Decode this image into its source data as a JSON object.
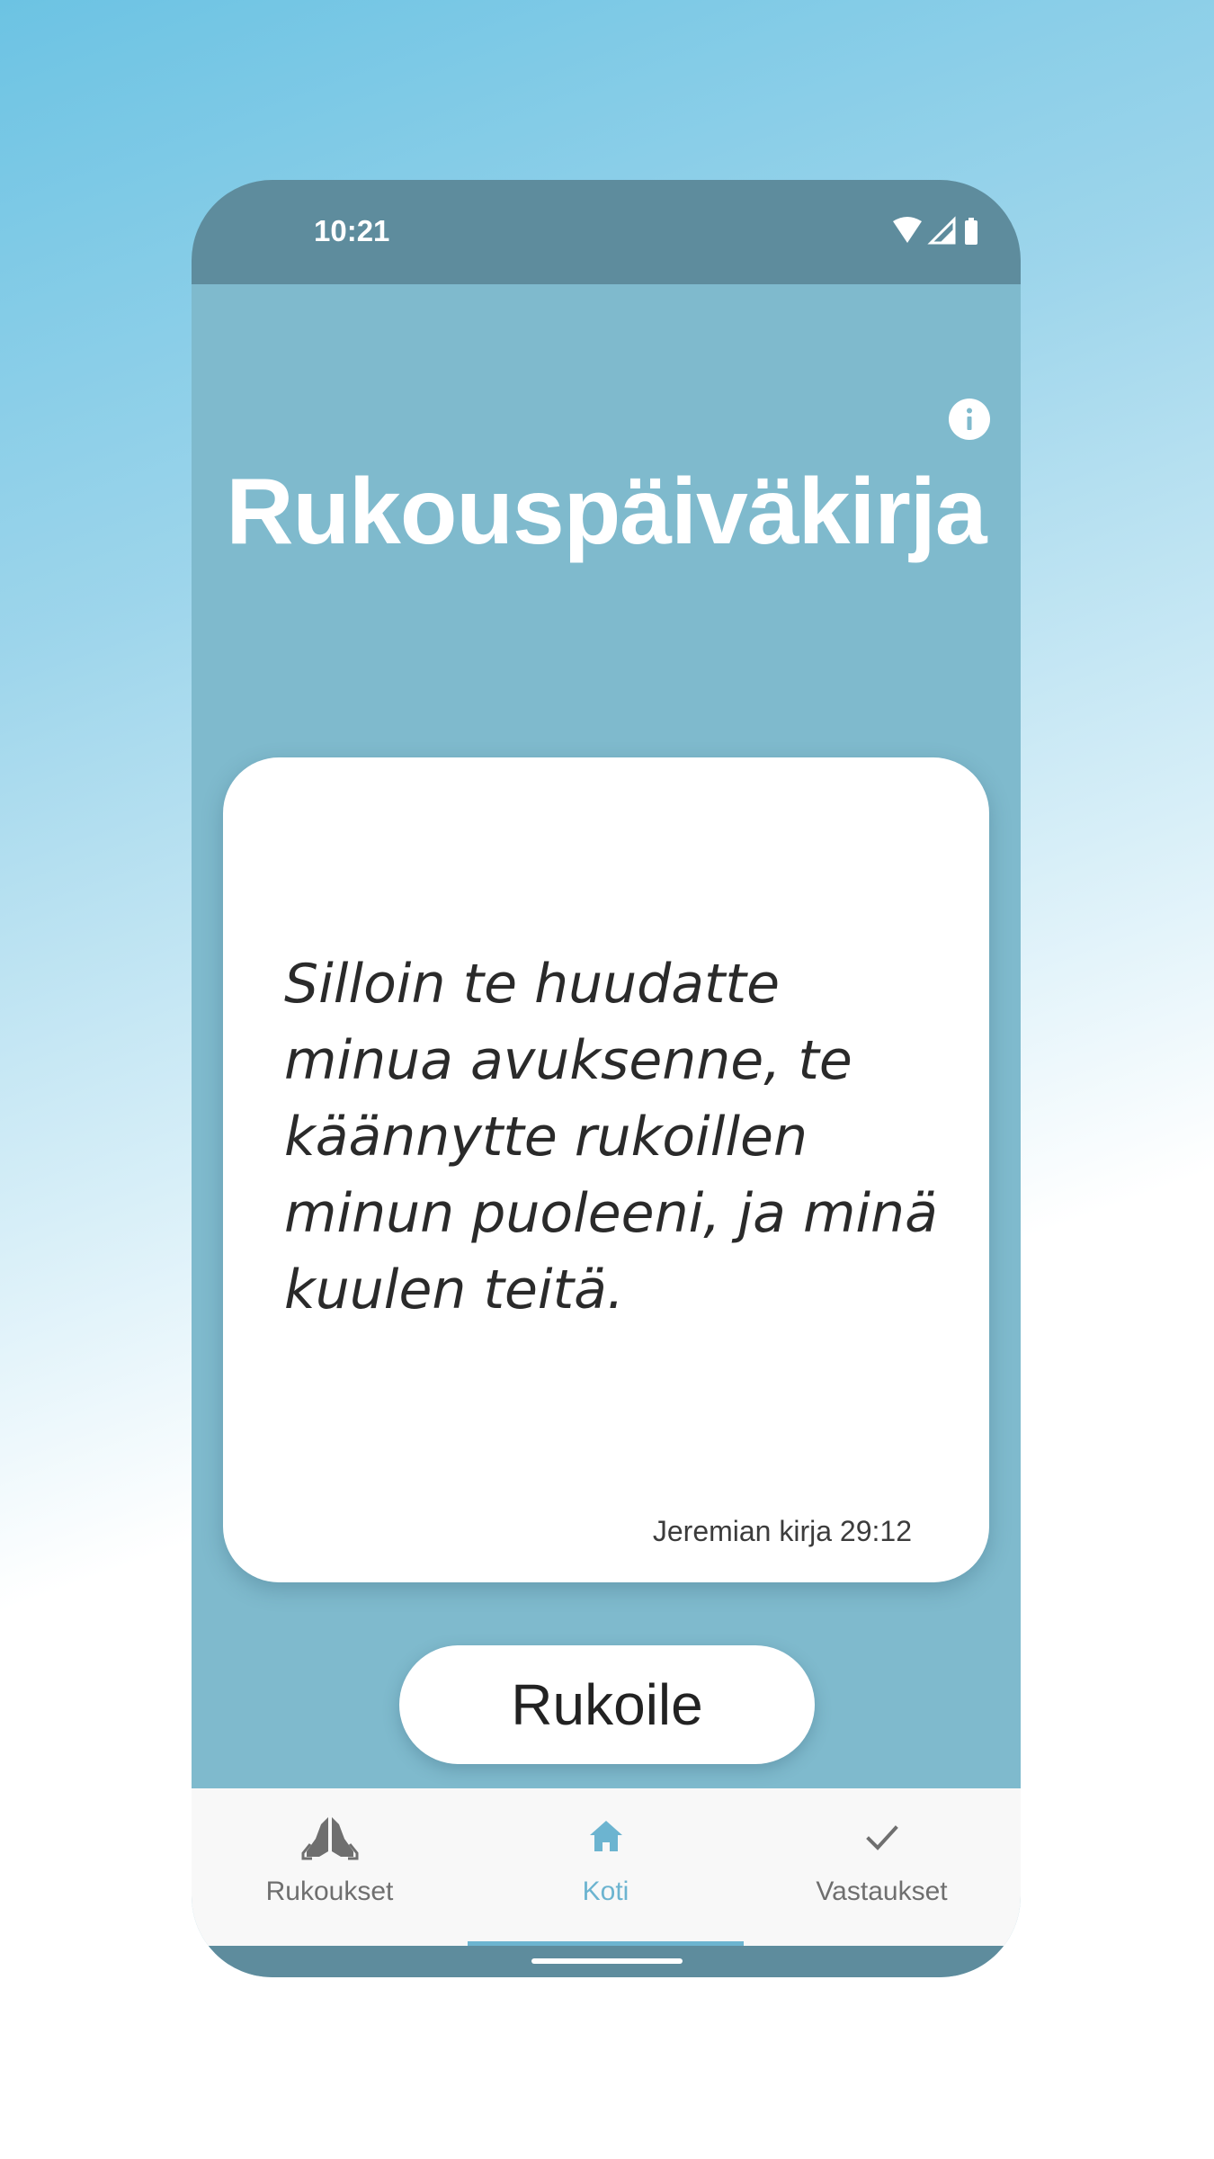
{
  "status_bar": {
    "time": "10:21",
    "icons": [
      "wifi-icon",
      "signal-icon",
      "battery-icon"
    ]
  },
  "header": {
    "title": "Rukouspäiväkirja",
    "info_icon": "info-icon"
  },
  "verse_card": {
    "text": "Silloin te huudatte minua avuksenne, te käännytte rukoillen minun puoleeni, ja minä kuulen teitä.",
    "reference": "Jeremian kirja 29:12"
  },
  "pray_button": {
    "label": "Rukoile"
  },
  "bottom_nav": {
    "active": "Koti",
    "items": [
      {
        "label": "Rukoukset",
        "icon": "praying-hands-icon"
      },
      {
        "label": "Koti",
        "icon": "home-icon"
      },
      {
        "label": "Vastaukset",
        "icon": "checkmark-icon"
      }
    ]
  },
  "colors": {
    "background": "#7fbacd",
    "status_bar": "#5e8c9d",
    "accent": "#6cb4d0",
    "card": "#ffffff",
    "nav_bar": "#f8f8f8"
  }
}
